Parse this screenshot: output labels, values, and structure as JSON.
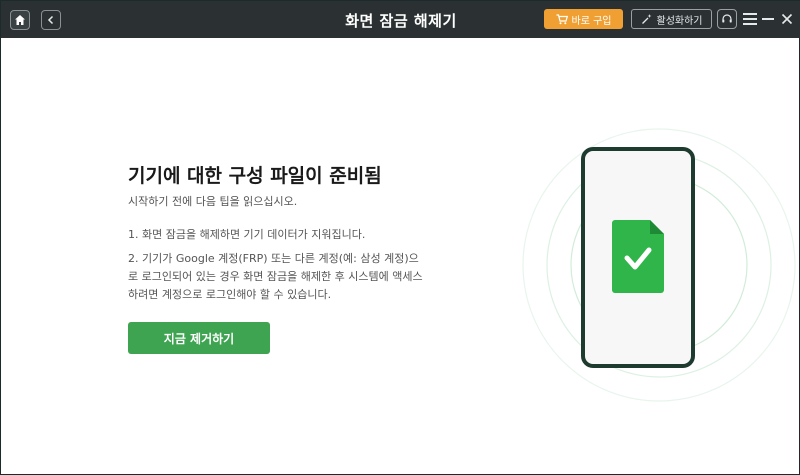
{
  "titlebar": {
    "title": "화면 잠금 해제기",
    "buy_label": "바로 구입",
    "activate_label": "활성화하기"
  },
  "content": {
    "heading": "기기에 대한 구성 파일이 준비됨",
    "subtitle": "시작하기 전에 다음 팁을 읽으십시오.",
    "tip1": "1. 화면 잠금을 해제하면 기기 데이터가 지워집니다.",
    "tip2": "2. 기기가 Google 계정(FRP) 또는 다른 계정(예: 삼성 계정)으로 로그인되어 있는 경우 화면 잠금을 해제한 후 시스템에 액세스하려면 계정으로 로그인해야 할 수 있습니다.",
    "remove_button": "지금 제거하기"
  },
  "colors": {
    "titlebar_bg": "#2b3133",
    "buy_button": "#f0a032",
    "primary_button": "#3fa451",
    "file_icon": "#2fb54a",
    "phone_frame": "#1e3b2f"
  },
  "icons": [
    "home-icon",
    "back-icon",
    "cart-icon",
    "magic-wand-icon",
    "support-icon",
    "menu-icon",
    "minimize-icon",
    "close-icon",
    "file-check-icon"
  ]
}
